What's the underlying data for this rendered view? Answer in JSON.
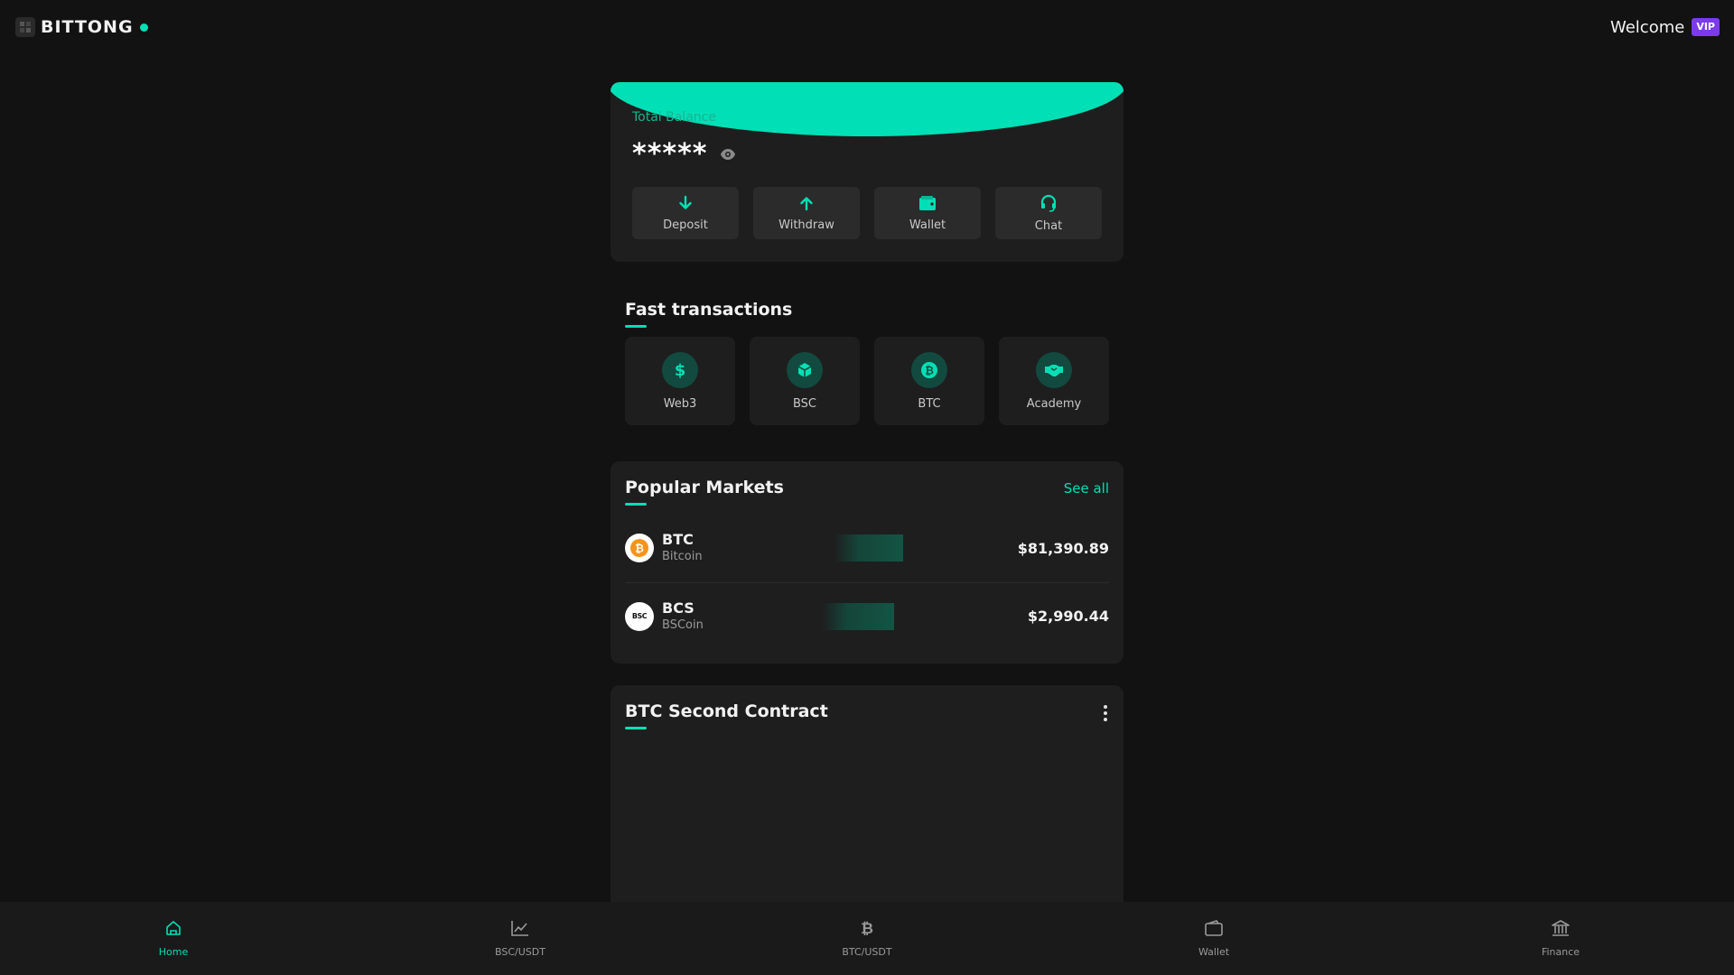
{
  "header": {
    "brand": "BITTONG",
    "welcome": "Welcome",
    "vip": "VIP"
  },
  "balance": {
    "label": "Total Balance",
    "masked_value": "*****",
    "actions": [
      {
        "label": "Deposit",
        "icon": "arrow-down-icon"
      },
      {
        "label": "Withdraw",
        "icon": "arrow-up-icon"
      },
      {
        "label": "Wallet",
        "icon": "wallet-icon"
      },
      {
        "label": "Chat",
        "icon": "headset-icon"
      }
    ]
  },
  "fast_transactions": {
    "title": "Fast transactions",
    "items": [
      {
        "label": "Web3",
        "icon": "dollar-icon"
      },
      {
        "label": "BSC",
        "icon": "cube-icon"
      },
      {
        "label": "BTC",
        "icon": "bitcoin-icon"
      },
      {
        "label": "Academy",
        "icon": "handshake-icon"
      }
    ]
  },
  "popular_markets": {
    "title": "Popular Markets",
    "see_all": "See all",
    "rows": [
      {
        "symbol": "BTC",
        "name": "Bitcoin",
        "price": "$81,390.89",
        "icon_text": "₿"
      },
      {
        "symbol": "BCS",
        "name": "BSCoin",
        "price": "$2,990.44",
        "icon_text": "BSC"
      }
    ]
  },
  "contract": {
    "title": "BTC Second Contract"
  },
  "bottom_nav": [
    {
      "label": "Home",
      "icon": "home-icon",
      "active": true
    },
    {
      "label": "BSC/USDT",
      "icon": "chart-line-icon",
      "active": false
    },
    {
      "label": "BTC/USDT",
      "icon": "bitcoin-icon",
      "active": false
    },
    {
      "label": "Wallet",
      "icon": "wallet-icon",
      "active": false
    },
    {
      "label": "Finance",
      "icon": "bank-icon",
      "active": false
    }
  ],
  "colors": {
    "accent": "#00dfb5",
    "background": "#121212",
    "card": "#1e1e1e",
    "vip": "#7c3aed",
    "btc_orange": "#f7931a"
  }
}
